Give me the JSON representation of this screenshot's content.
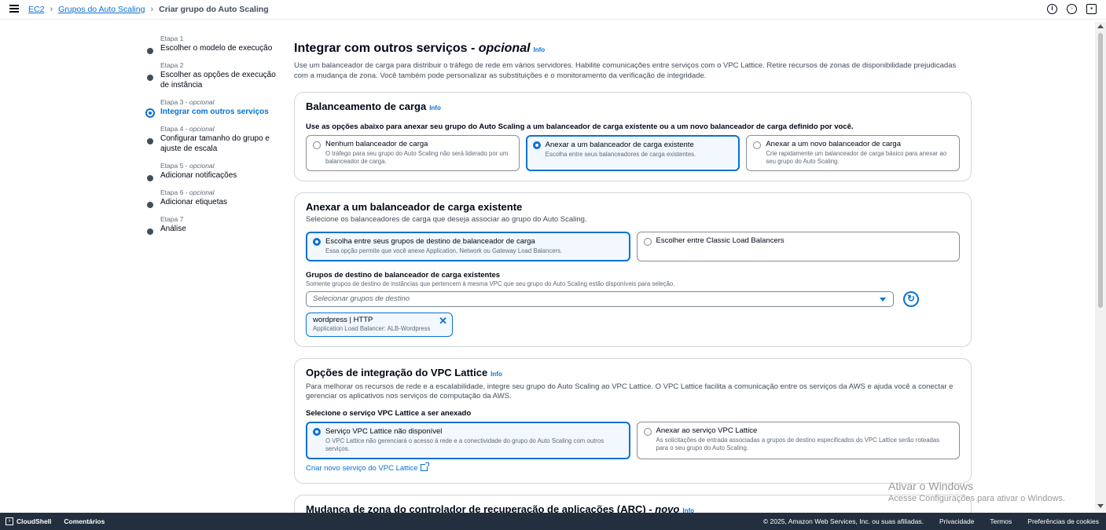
{
  "breadcrumb": {
    "items": [
      "EC2",
      "Grupos do Auto Scaling"
    ],
    "current": "Criar grupo do Auto Scaling"
  },
  "steps": [
    {
      "label": "Etapa 1",
      "optional": "",
      "title": "Escolher o modelo de execução"
    },
    {
      "label": "Etapa 2",
      "optional": "",
      "title": "Escolher as opções de execução de instância"
    },
    {
      "label": "Etapa 3 -",
      "optional": "opcional",
      "title": "Integrar com outros serviços"
    },
    {
      "label": "Etapa 4 -",
      "optional": "opcional",
      "title": "Configurar tamanho do grupo e ajuste de escala"
    },
    {
      "label": "Etapa 5 -",
      "optional": "opcional",
      "title": "Adicionar notificações"
    },
    {
      "label": "Etapa 6 -",
      "optional": "opcional",
      "title": "Adicionar etiquetas"
    },
    {
      "label": "Etapa 7",
      "optional": "",
      "title": "Análise"
    }
  ],
  "page": {
    "title": "Integrar com outros serviços -",
    "title_optional": "opcional",
    "info": "Info",
    "description": "Use um balanceador de carga para distribuir o tráfego de rede em vários servidores. Habilite comunicações entre serviços com o VPC Lattice. Retire recursos de zonas de disponibilidade prejudicadas com a mudança de zona. Você também pode personalizar as substituições e o monitoramento da verificação de integridade."
  },
  "lb_panel": {
    "title": "Balanceamento de carga",
    "info": "Info",
    "label": "Use as opções abaixo para anexar seu grupo do Auto Scaling a um balanceador de carga existente ou a um novo balanceador de carga definido por você.",
    "options": [
      {
        "title": "Nenhum balanceador de carga",
        "desc": "O tráfego para seu grupo do Auto Scaling não será liderado por um balanceador de carga."
      },
      {
        "title": "Anexar a um balanceador de carga existente",
        "desc": "Escolha entre seus balanceadores de carga existentes."
      },
      {
        "title": "Anexar a um novo balanceador de carga",
        "desc": "Crie rapidamente um balanceador de carga básico para anexar ao seu grupo do Auto Scaling."
      }
    ]
  },
  "existing_panel": {
    "title": "Anexar a um balanceador de carga existente",
    "subtitle": "Selecione os balanceadores de carga que deseja associar ao grupo do Auto Scaling.",
    "options": [
      {
        "title": "Escolha entre seus grupos de destino de balanceador de carga",
        "desc": "Essa opção permite que você anexe Application, Network ou Gateway Load Balancers."
      },
      {
        "title": "Escolher entre Classic Load Balancers",
        "desc": ""
      }
    ],
    "field_label": "Grupos de destino de balanceador de carga existentes",
    "field_desc": "Somente grupos de destino de instâncias que pertencem à mesma VPC que seu grupo do Auto Scaling estão disponíveis para seleção.",
    "select_placeholder": "Selecionar grupos de destino",
    "token": {
      "title": "wordpress | HTTP",
      "desc": "Application Load Balancer: ALB-Wordpress"
    }
  },
  "vpc_panel": {
    "title": "Opções de integração do VPC Lattice",
    "info": "Info",
    "subtitle": "Para melhorar os recursos de rede e a escalabilidade, integre seu grupo do Auto Scaling ao VPC Lattice. O VPC Lattice facilita a comunicação entre os serviços da AWS e ajuda você a conectar e gerenciar os aplicativos nos serviços de computação da AWS.",
    "label": "Selecione o serviço VPC Lattice a ser anexado",
    "options": [
      {
        "title": "Serviço VPC Lattice não disponível",
        "desc": "O VPC Lattice não gerenciará o acesso à rede e a conectividade do grupo do Auto Scaling com outros serviços."
      },
      {
        "title": "Anexar ao serviço VPC Lattice",
        "desc": "As solicitações de entrada associadas a grupos de destino especificados do VPC Lattice serão roteadas para o seu grupo do Auto Scaling."
      }
    ],
    "link": "Criar novo serviço do VPC Lattice"
  },
  "arc_panel": {
    "title": "Mudança de zona do controlador de recuperação de aplicações (ARC) -",
    "title_new": "novo",
    "info": "Info"
  },
  "watermark": {
    "line1": "Ativar o Windows",
    "line2": "Acesse Configurações para ativar o Windows."
  },
  "footer": {
    "cloudshell": "CloudShell",
    "feedback": "Comentários",
    "copyright": "© 2025, Amazon Web Services, Inc. ou suas afiliadas.",
    "privacy": "Privacidade",
    "terms": "Termos",
    "cookies": "Preferências de cookies"
  }
}
